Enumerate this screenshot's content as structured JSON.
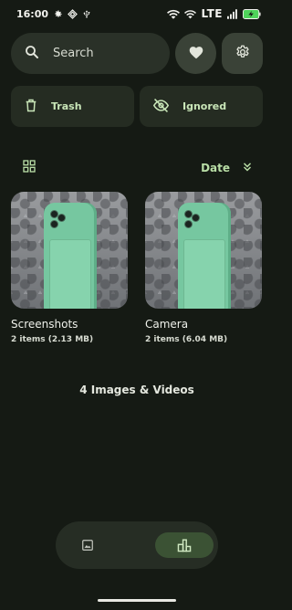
{
  "status_bar": {
    "time": "16:00",
    "network": "LTE",
    "icons": [
      "settings-icon",
      "diamond-icon",
      "usb-icon",
      "wifi-icon",
      "wifi-icon",
      "signal-icon",
      "battery-charging-icon"
    ]
  },
  "search": {
    "label": "Search"
  },
  "actions": {
    "trash_label": "Trash",
    "ignored_label": "Ignored"
  },
  "toolbar": {
    "sort_label": "Date"
  },
  "albums": [
    {
      "title": "Screenshots",
      "subtitle": "2 items (2.13 MB)"
    },
    {
      "title": "Camera",
      "subtitle": "2 items (6.04 MB)"
    }
  ],
  "summary": {
    "count_label": "4 Images & Videos"
  },
  "colors": {
    "background": "#151a14",
    "surface": "#2a3128",
    "accent": "#b9dea6",
    "active_nav": "#3b5234"
  }
}
